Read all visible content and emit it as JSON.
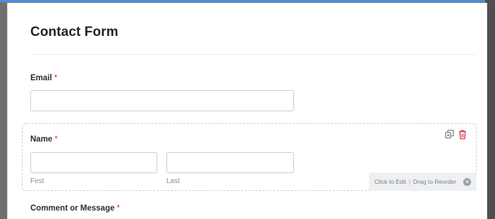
{
  "form": {
    "title": "Contact Form",
    "fields": {
      "email": {
        "label": "Email",
        "required_mark": "*",
        "value": "",
        "placeholder": ""
      },
      "name": {
        "label": "Name",
        "required_mark": "*",
        "first": {
          "value": "",
          "placeholder": "",
          "sublabel": "First"
        },
        "last": {
          "value": "",
          "placeholder": "",
          "sublabel": "Last"
        }
      },
      "comment": {
        "label": "Comment or Message",
        "required_mark": "*"
      }
    }
  },
  "field_actions": {
    "duplicate_icon": "duplicate-icon",
    "delete_icon": "trash-icon"
  },
  "hint": {
    "edit_text": "Click to Edit",
    "separator": "|",
    "reorder_text": "Drag to Reorder",
    "close_glyph": "✕"
  },
  "colors": {
    "required": "#e0243a",
    "delete": "#d6304a",
    "accent": "#4a90e2"
  }
}
